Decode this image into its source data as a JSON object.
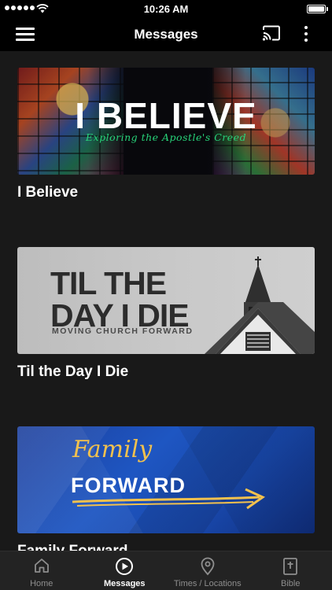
{
  "status_bar": {
    "time": "10:26 AM"
  },
  "header": {
    "title": "Messages"
  },
  "messages": [
    {
      "title": "I Believe",
      "art_title": "I BELIEVE",
      "art_subtitle": "Exploring the Apostle's Creed"
    },
    {
      "title": "Til the Day I Die",
      "art_line1": "TIL THE",
      "art_line2": "DAY I DIE",
      "art_tagline": "MOVING CHURCH FORWARD"
    },
    {
      "title": "Family Forward",
      "art_line1": "Family",
      "art_line2": "FORWARD"
    }
  ],
  "tabs": [
    {
      "label": "Home",
      "icon": "home-icon",
      "active": false
    },
    {
      "label": "Messages",
      "icon": "play-circle-icon",
      "active": true
    },
    {
      "label": "Times / Locations",
      "icon": "map-pin-icon",
      "active": false
    },
    {
      "label": "Bible",
      "icon": "bible-icon",
      "active": false
    }
  ],
  "colors": {
    "accent_green": "#27d47a",
    "accent_gold": "#f2c14e",
    "tab_inactive": "#8e8e8e",
    "background": "#191919"
  }
}
